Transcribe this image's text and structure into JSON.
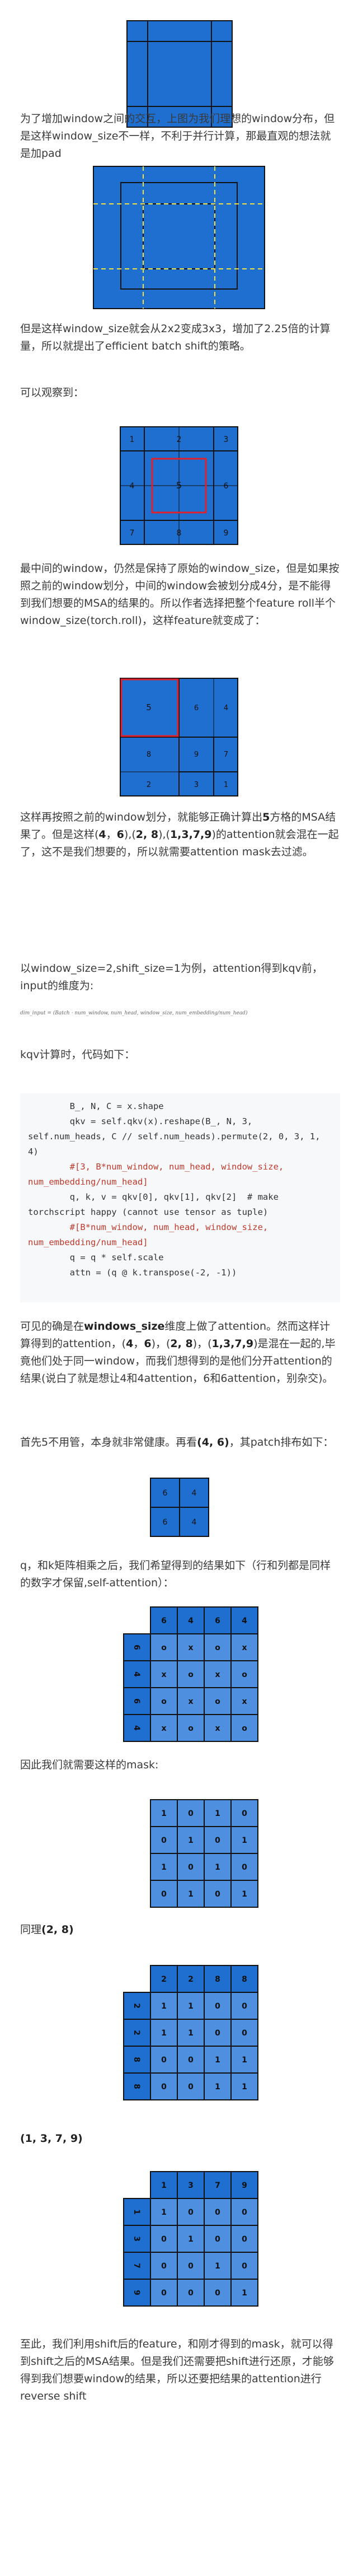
{
  "colors": {
    "blue": "#1e6fd0",
    "grid_line": "#111111",
    "light_blue": "#4f8fe0",
    "red": "#e0202a",
    "yellow": "#f2e23a"
  },
  "paragraphs": {
    "p1": "为了增加window之间的交互，上图为我们理想的window分布，但是这样window_size不一样，不利于并行计算，那最直观的想法就是加pad",
    "p2": "但是这样window_size就会从2x2变成3x3，增加了2.25倍的计算量，所以就提出了efficient batch shift的策略。",
    "p3": "可以观察到：",
    "p4": "最中间的window，仍然是保持了原始的window_size，但是如果按照之前的window划分，中间的window会被划分成4分，是不能得到我们想要的MSA的结果的。所以作者选择把整个feature roll半个window_size(torch.roll)，这样feature就变成了：",
    "p5a": "这样再按照之前的window划分，就能够正确计算出",
    "p5b": "5",
    "p5c": "方格的MSA结果了。但是这样(",
    "p5d": "4",
    "p5e": "，",
    "p5f": "6",
    "p5g": "),(",
    "p5h": "2, 8",
    "p5i": "),(",
    "p5j": "1,3,7,9",
    "p5k": ")的attention就会混在一起了，这不是我们想要的，所以就需要attention mask去过滤。",
    "p6": "以window_size=2,shift_size=1为例，attention得到kqv前，input的维度为:",
    "p7": "kqv计算时，代码如下：",
    "p8a": "可见的确是在",
    "p8b": "windows_size",
    "p8c": "维度上做了attention。然而这样计算得到的attention，(",
    "p8d": "4",
    "p8e": "，",
    "p8f": "6",
    "p8g": ")，(",
    "p8h": "2, 8",
    "p8i": ")，(",
    "p8j": "1,3,7,9",
    "p8k": ")是混在一起的,毕竟他们处于同一window，而我们想得到的是他们分开attention的结果(说白了就是想让4和4attention，6和6attention，别杂交)。",
    "p9a": "首先5不用管，本身就非常健康。再看",
    "p9b": "(4, 6)",
    "p9c": "，其patch排布如下：",
    "p10": "q，和k矩阵相乘之后，我们希望得到的结果如下（行和列都是同样的数字才保留,self-attention）：",
    "p11": "因此我们就需要这样的mask:",
    "p12": "同理(2, 8)",
    "p13": "(1, 3, 7, 9)",
    "p14": "至此，我们利用shift后的feature，和刚才得到的mask，就可以得到shift之后的MSA结果。但是我们还需要把shift进行还原，才能够得到我们想要window的结果，所以还要把结果的attention进行reverse shift"
  },
  "formula": "dim_input = (Batch · num_window, num_head, window_size, num_embedding/num_head)",
  "code_lines": [
    "        B_, N, C = x.shape",
    "        qkv = self.qkv(x).reshape(B_, N, 3, self.num_heads, C // self.num_heads).permute(2, 0, 3, 1, 4)",
    "        #[3, B*num_window, num_head, window_size, num_embedding/num_head]",
    "        q, k, v = qkv[0], qkv[1], qkv[2]  # make torchscript happy (cannot use tensor as tuple)",
    "        #[B*num_window, num_head, window_size, num_embedding/num_head]",
    "        q = q * self.scale",
    "        attn = (q @ k.transpose(-2, -1))"
  ],
  "fig3_labels": [
    "1",
    "2",
    "3",
    "4",
    "5",
    "6",
    "7",
    "8",
    "9"
  ],
  "fig4_labels": [
    "5",
    "6",
    "4",
    "8",
    "9",
    "7",
    "2",
    "3",
    "1"
  ],
  "patch_46": [
    "6",
    "4",
    "6",
    "4"
  ],
  "mask_46": {
    "cols": [
      "6",
      "4",
      "6",
      "4"
    ],
    "rows": [
      "6",
      "4",
      "6",
      "4"
    ],
    "cells": [
      [
        "o",
        "x",
        "o",
        "x"
      ],
      [
        "x",
        "o",
        "x",
        "o"
      ],
      [
        "o",
        "x",
        "o",
        "x"
      ],
      [
        "x",
        "o",
        "x",
        "o"
      ]
    ],
    "mask": [
      [
        "1",
        "0",
        "1",
        "0"
      ],
      [
        "0",
        "1",
        "0",
        "1"
      ],
      [
        "1",
        "0",
        "1",
        "0"
      ],
      [
        "0",
        "1",
        "0",
        "1"
      ]
    ]
  },
  "mask_28": {
    "cols": [
      "2",
      "2",
      "8",
      "8"
    ],
    "rows": [
      "2",
      "2",
      "8",
      "8"
    ],
    "mask": [
      [
        "1",
        "1",
        "0",
        "0"
      ],
      [
        "1",
        "1",
        "0",
        "0"
      ],
      [
        "0",
        "0",
        "1",
        "1"
      ],
      [
        "0",
        "0",
        "1",
        "1"
      ]
    ]
  },
  "mask_1379": {
    "cols": [
      "1",
      "3",
      "7",
      "9"
    ],
    "rows": [
      "1",
      "3",
      "7",
      "9"
    ],
    "mask": [
      [
        "1",
        "0",
        "0",
        "0"
      ],
      [
        "0",
        "1",
        "0",
        "0"
      ],
      [
        "0",
        "0",
        "1",
        "0"
      ],
      [
        "0",
        "0",
        "0",
        "1"
      ]
    ]
  }
}
